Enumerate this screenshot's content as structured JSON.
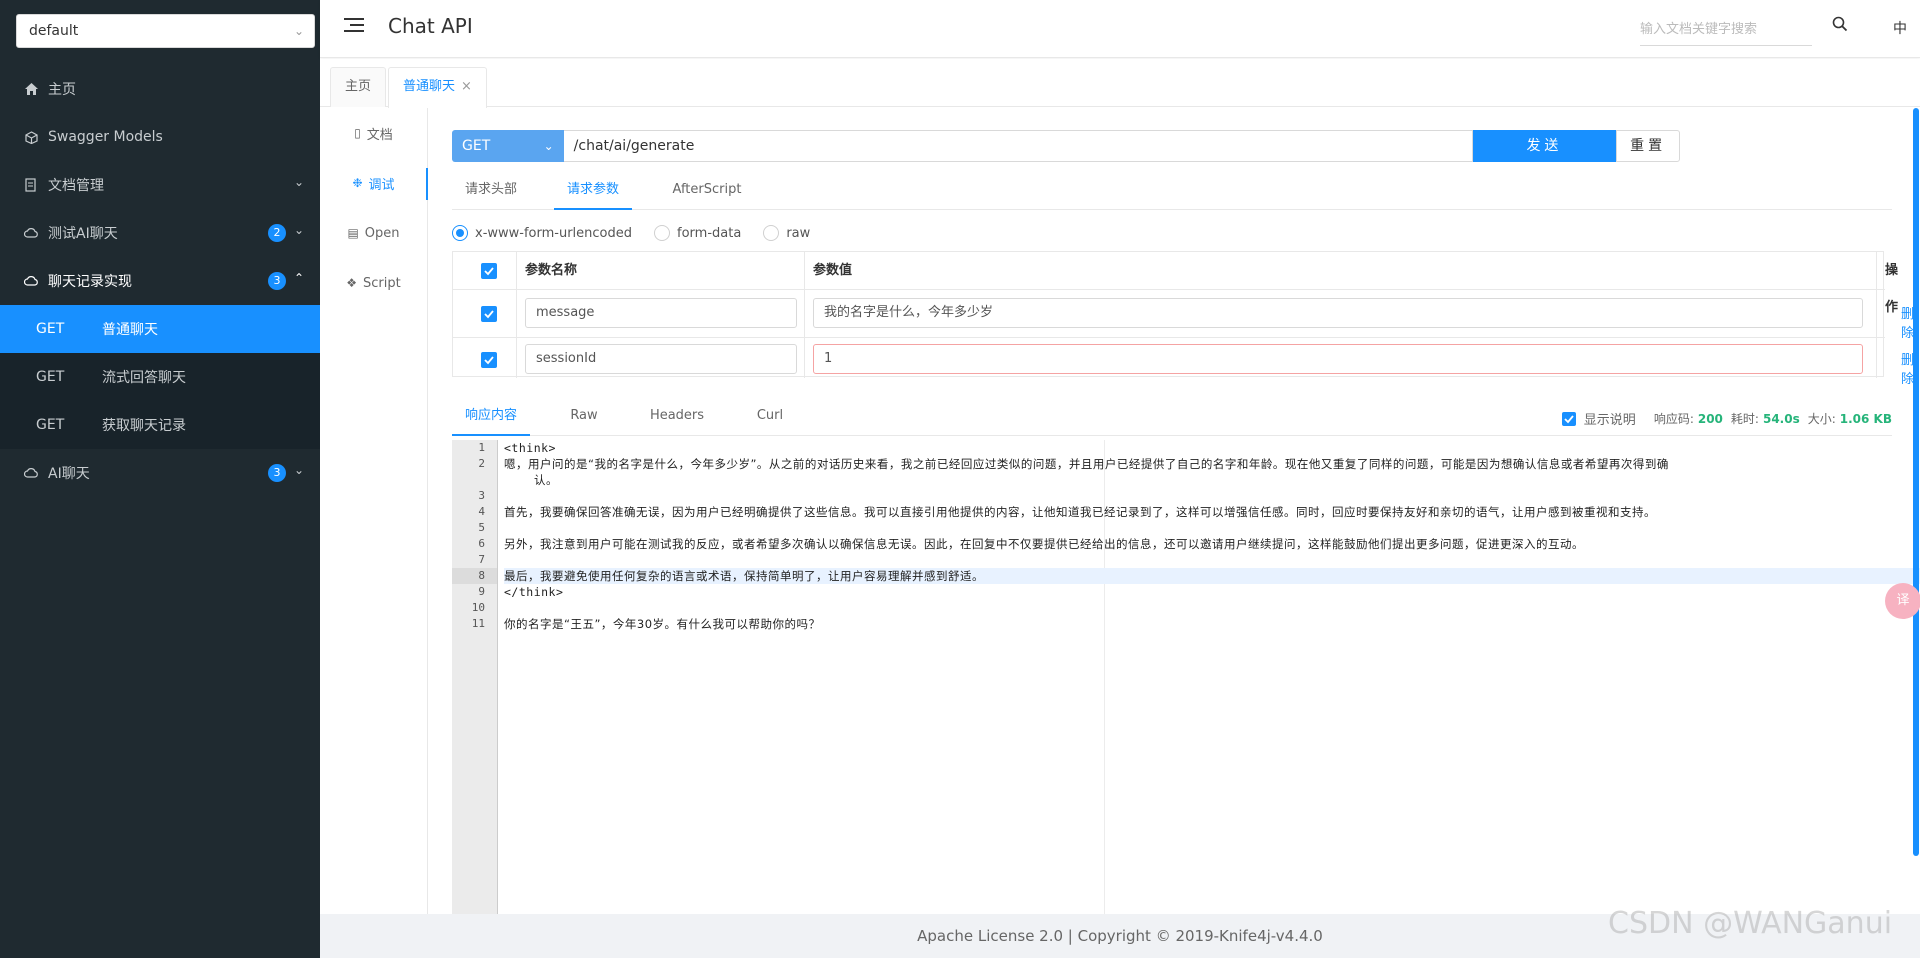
{
  "sidebar": {
    "group": "default",
    "menu": [
      {
        "label": "主页",
        "icon": "home-icon"
      },
      {
        "label": "Swagger Models",
        "icon": "cube-icon"
      },
      {
        "label": "文档管理",
        "icon": "document-manage-icon"
      },
      {
        "label": "测试AI聊天",
        "icon": "cloud-icon",
        "badge": "2"
      },
      {
        "label": "聊天记录实现",
        "icon": "cloud-icon",
        "badge": "3"
      },
      {
        "label": "AI聊天",
        "icon": "cloud-icon",
        "badge": "3"
      }
    ],
    "submenu": [
      {
        "method": "GET",
        "label": "普通聊天"
      },
      {
        "method": "GET",
        "label": "流式回答聊天"
      },
      {
        "method": "GET",
        "label": "获取聊天记录"
      }
    ]
  },
  "header": {
    "title": "Chat API",
    "search_placeholder": "输入文档关键字搜索",
    "lang": "中"
  },
  "tabs": [
    {
      "label": "主页"
    },
    {
      "label": "普通聊天"
    }
  ],
  "side_tabs": [
    {
      "label": "文档",
      "icon": "document-icon"
    },
    {
      "label": "调试",
      "icon": "bug-icon"
    },
    {
      "label": "Open",
      "icon": "file-icon"
    },
    {
      "label": "Script",
      "icon": "script-icon"
    }
  ],
  "request": {
    "method": "GET",
    "url": "/chat/ai/generate",
    "send_label": "发送",
    "reset_label": "重置",
    "tabs": [
      "请求头部",
      "请求参数",
      "AfterScript"
    ],
    "content_types": [
      "x-www-form-urlencoded",
      "form-data",
      "raw"
    ],
    "table_headers": [
      "参数名称",
      "参数值",
      "操作"
    ],
    "params": [
      {
        "name": "message",
        "value": "我的名字是什么，今年多少岁",
        "action": "删除"
      },
      {
        "name": "sessionId",
        "value": "1",
        "action": "删除"
      }
    ]
  },
  "response": {
    "tabs": [
      "响应内容",
      "Raw",
      "Headers",
      "Curl"
    ],
    "show_desc": "显示说明",
    "code_label": "响应码:",
    "code": "200",
    "time_label": "耗时:",
    "time": "54.0s",
    "size_label": "大小:",
    "size": "1.06 KB",
    "lines": [
      {
        "n": "1",
        "text": "<think>"
      },
      {
        "n": "2",
        "text": "嗯，用户问的是“我的名字是什么，今年多少岁”。从之前的对话历史来看，我之前已经回应过类似的问题，并且用户已经提供了自己的名字和年龄。现在他又重复了同样的问题，可能是因为想确认信息或者希望再次得到确"
      },
      {
        "n": "",
        "text": "认。"
      },
      {
        "n": "3",
        "text": ""
      },
      {
        "n": "4",
        "text": "首先，我要确保回答准确无误，因为用户已经明确提供了这些信息。我可以直接引用他提供的内容，让他知道我已经记录到了，这样可以增强信任感。同时，回应时要保持友好和亲切的语气，让用户感到被重视和支持。"
      },
      {
        "n": "5",
        "text": ""
      },
      {
        "n": "6",
        "text": "另外，我注意到用户可能在测试我的反应，或者希望多次确认以确保信息无误。因此，在回复中不仅要提供已经给出的信息，还可以邀请用户继续提问，这样能鼓励他们提出更多问题，促进更深入的互动。"
      },
      {
        "n": "7",
        "text": ""
      },
      {
        "n": "8",
        "text": "最后，我要避免使用任何复杂的语言或术语，保持简单明了，让用户容易理解并感到舒适。"
      },
      {
        "n": "9",
        "text": "</think>"
      },
      {
        "n": "10",
        "text": ""
      },
      {
        "n": "11",
        "text": "你的名字是“王五”，今年30岁。有什么我可以帮助你的吗？"
      }
    ]
  },
  "footer": "Apache License 2.0 | Copyright © 2019-Knife4j-v4.4.0",
  "watermark": "CSDN @WANGanui",
  "float_button": "译",
  "colors": {
    "primary": "#1890ff",
    "sidebar": "#1f2a30",
    "success": "#26b47a"
  }
}
